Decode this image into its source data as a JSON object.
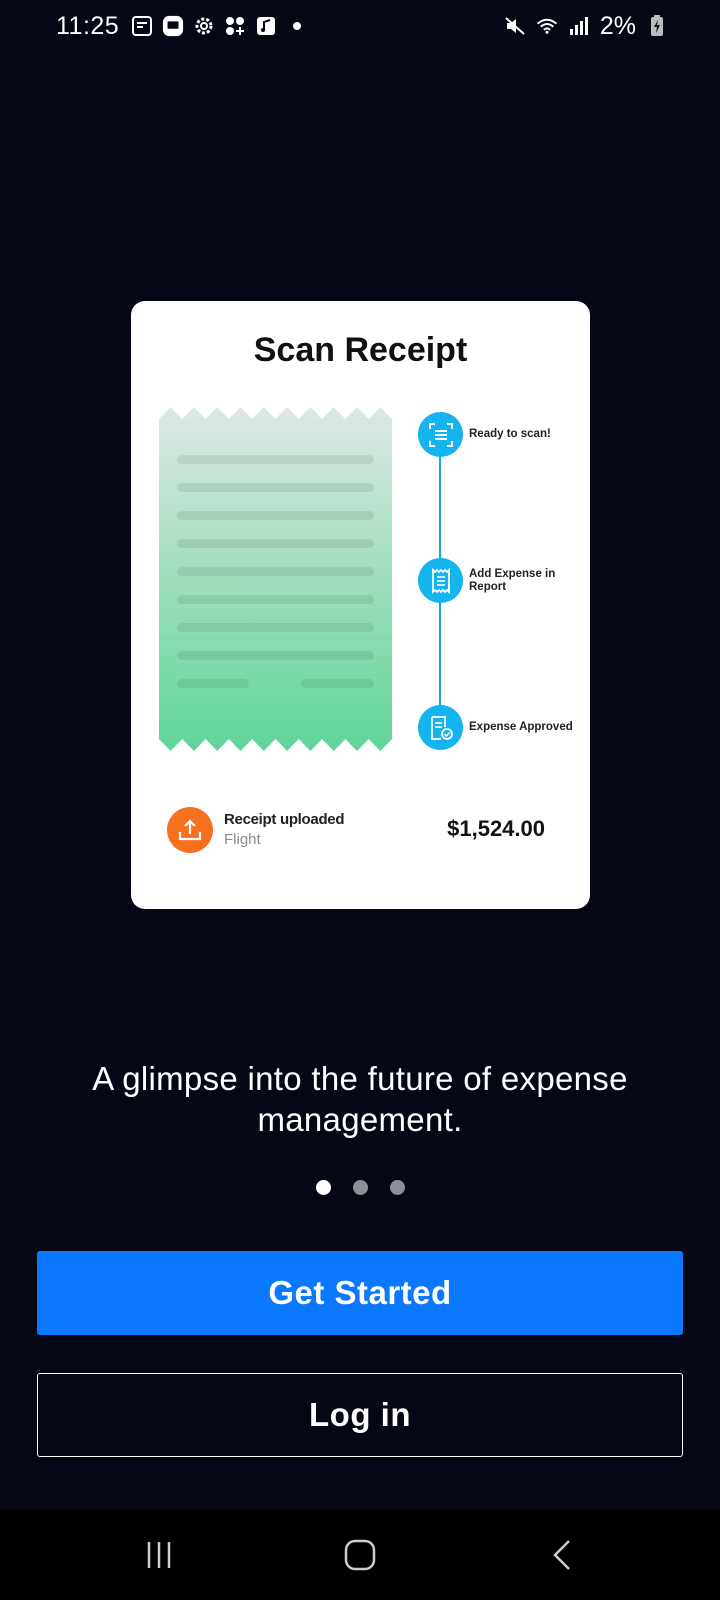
{
  "status_bar": {
    "time": "11:25",
    "battery": "2%",
    "left_icons": [
      "notification-icon",
      "chat-icon",
      "settings-icon",
      "apps-icon",
      "music-icon",
      "dot-icon"
    ],
    "right_icons": [
      "mute-icon",
      "wifi-icon",
      "signal-icon",
      "battery-charging-icon"
    ]
  },
  "card": {
    "title": "Scan Receipt",
    "steps": [
      {
        "label": "Ready to scan!",
        "icon": "scan-icon"
      },
      {
        "label": "Add Expense in Report",
        "icon": "receipt-icon"
      },
      {
        "label": "Expense Approved",
        "icon": "approved-doc-icon"
      }
    ],
    "upload": {
      "title": "Receipt uploaded",
      "subtitle": "Flight",
      "amount": "$1,524.00",
      "icon": "upload-icon"
    }
  },
  "tagline": "A glimpse into the future of expense management.",
  "pager": {
    "count": 3,
    "active_index": 0
  },
  "buttons": {
    "primary_label": "Get Started",
    "secondary_label": "Log in"
  },
  "nav": {
    "items": [
      "recent-apps-icon",
      "home-icon",
      "back-icon"
    ]
  },
  "colors": {
    "background": "#050814",
    "primary": "#0a78ff",
    "step_accent": "#14b4ef",
    "upload_accent": "#f5711d",
    "receipt_gradient_top": "#dde8e4",
    "receipt_gradient_bottom": "#5fd598"
  }
}
